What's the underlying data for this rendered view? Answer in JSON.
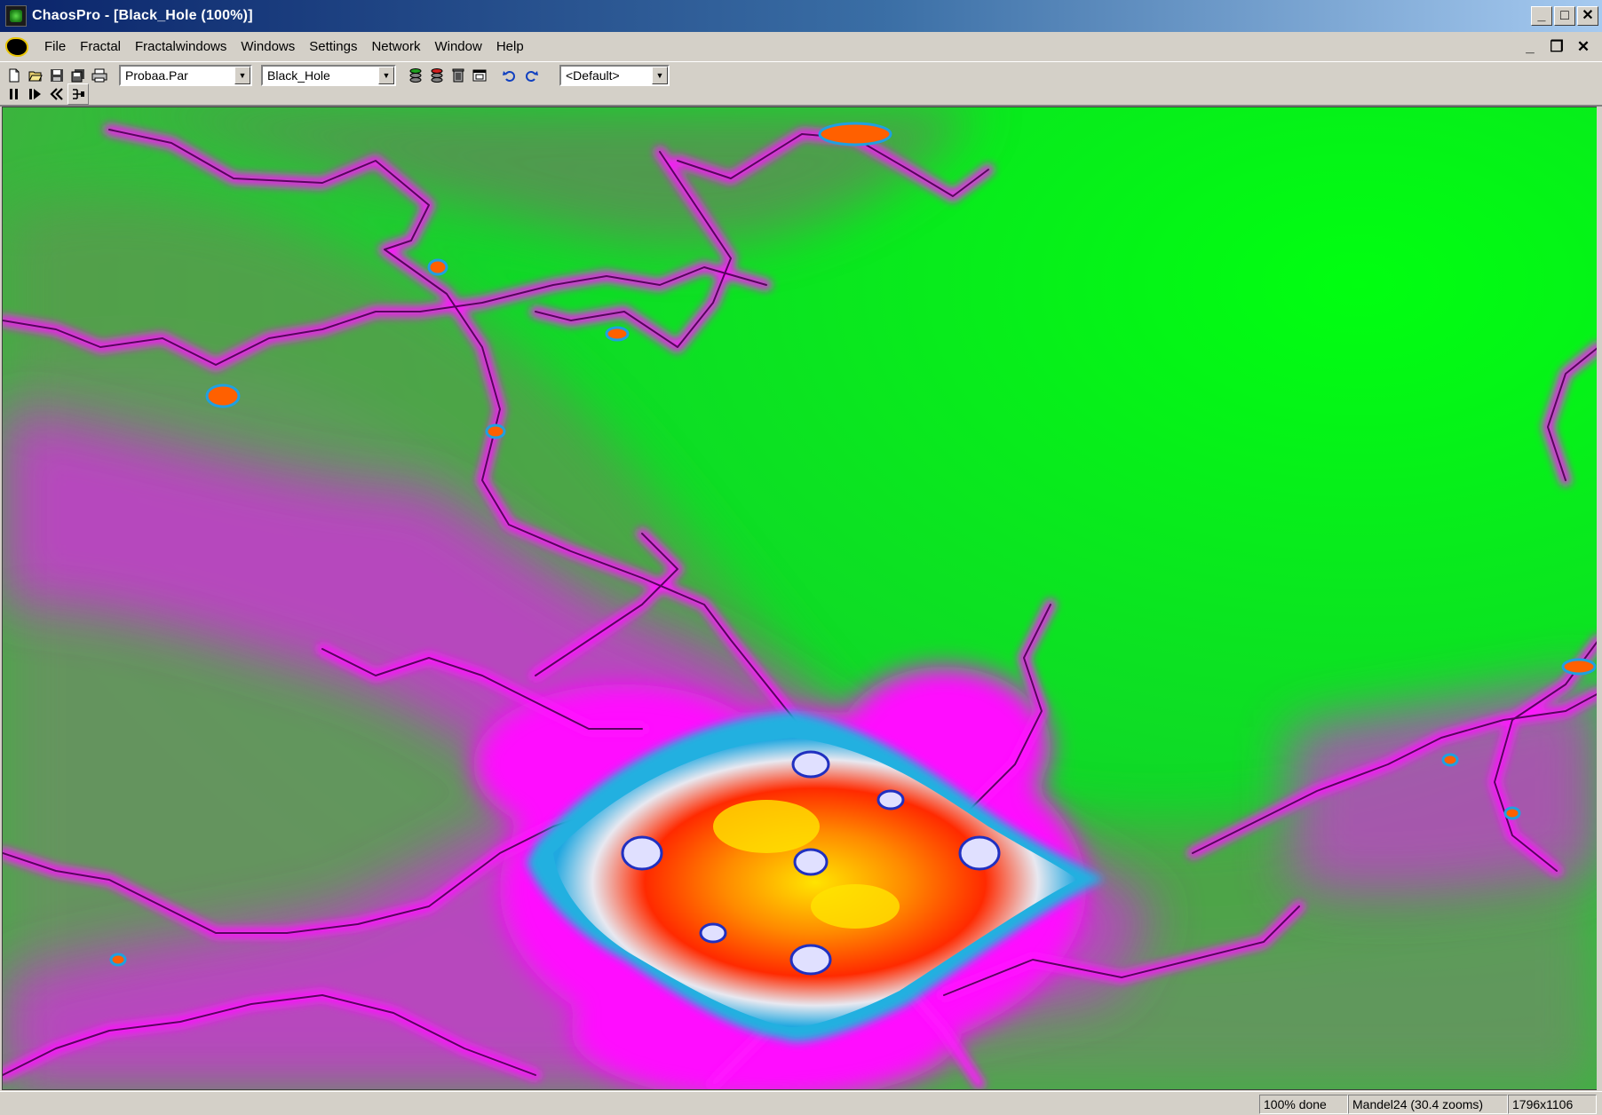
{
  "window": {
    "title": "ChaosPro - [Black_Hole (100%)]",
    "controls": {
      "minimize": "_",
      "maximize": "□",
      "close": "✕"
    }
  },
  "menubar": {
    "items": [
      "File",
      "Fractal",
      "Fractalwindows",
      "Windows",
      "Settings",
      "Network",
      "Window",
      "Help"
    ],
    "mdi_controls": {
      "minimize": "_",
      "restore": "❐",
      "close": "✕"
    }
  },
  "toolbar": {
    "param_file": "Probaa.Par",
    "fractal_name": "Black_Hole",
    "preset": "<Default>"
  },
  "colors": {
    "green": "#00e010",
    "magenta": "#ff00ff",
    "grey": "#888888",
    "cyan": "#20b0e0",
    "orange": "#ff6a00",
    "yellow": "#ffe000",
    "red": "#ff2000"
  },
  "status": {
    "progress": "100% done",
    "formula": "Mandel24 (30.4 zooms)",
    "size": "1796x1106"
  }
}
